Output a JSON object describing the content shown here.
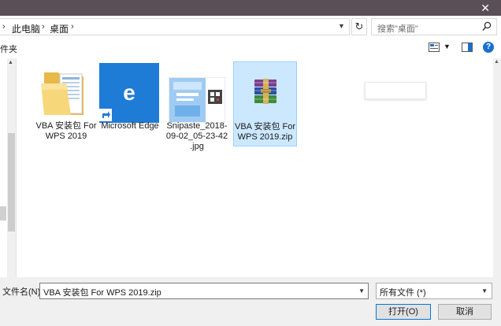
{
  "titlebar": {
    "close_glyph": "✕"
  },
  "address": {
    "crumbs": [
      "此电脑",
      "桌面"
    ],
    "search_placeholder": "搜索\"桌面\""
  },
  "toolbar": {
    "new_folder": "件夹"
  },
  "items": [
    {
      "name": "VBA 安装包 For WPS 2019",
      "line1": "VBA 安装包 For",
      "line2": "WPS 2019",
      "line3": "",
      "icon": "folder-icon"
    },
    {
      "name": "Microsoft Edge",
      "line1": "Microsoft Edge",
      "line2": "",
      "line3": "",
      "icon": "edge-icon"
    },
    {
      "name": "Snipaste_2018-09-02_05-23-42.jpg",
      "line1": "Snipaste_2018-",
      "line2": "09-02_05-23-42",
      "line3": ".jpg",
      "icon": "image-thumbnail"
    },
    {
      "name": "VBA 安装包 For WPS 2019.zip",
      "line1": "VBA 安装包 For",
      "line2": "WPS 2019.zip",
      "line3": "",
      "icon": "winrar-archive-icon"
    }
  ],
  "bottom": {
    "filename_label": "文件名(N):",
    "filename_value": "VBA 安装包 For WPS 2019.zip",
    "filetype_value": "所有文件 (*)",
    "open_label": "打开(O)",
    "cancel_label": "取消"
  },
  "colors": {
    "selection": "#cce8ff",
    "edge_tile": "#1e7bd6",
    "titlebar": "#5a4f56"
  }
}
